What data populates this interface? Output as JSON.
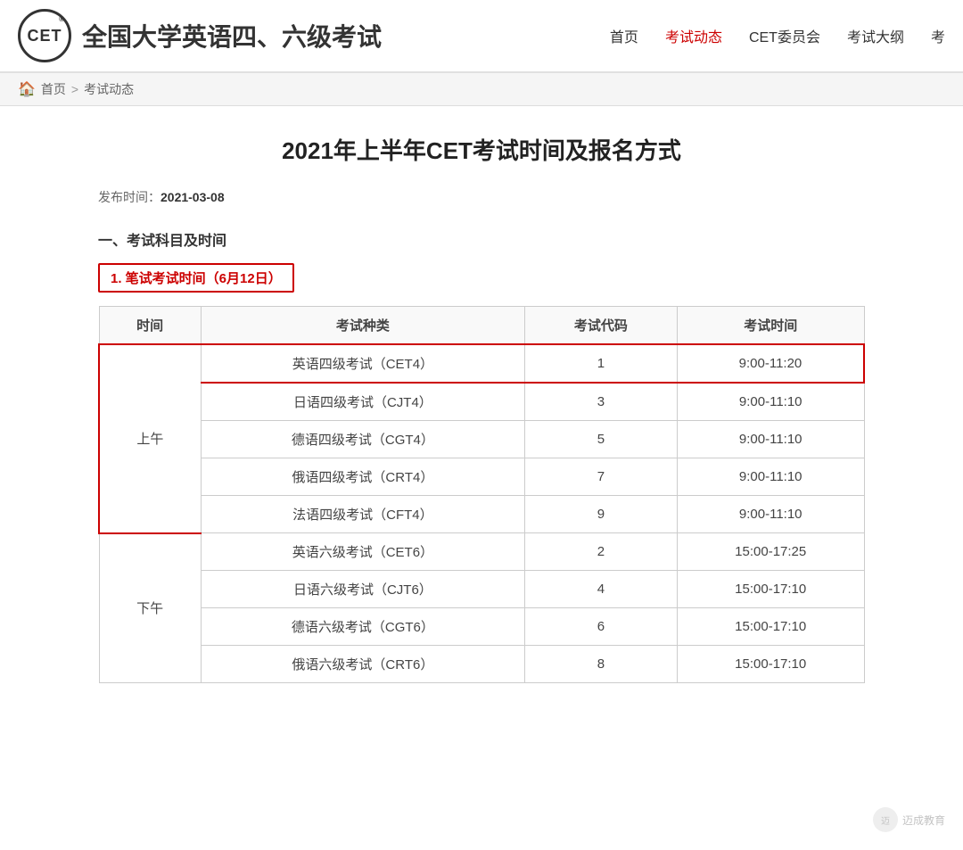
{
  "header": {
    "logo_text": "CET",
    "logo_trademark": "®",
    "site_title": "全国大学英语四、六级考试",
    "nav": [
      {
        "label": "首页",
        "active": false
      },
      {
        "label": "考试动态",
        "active": true
      },
      {
        "label": "CET委员会",
        "active": false
      },
      {
        "label": "考试大纲",
        "active": false
      },
      {
        "label": "考",
        "active": false
      }
    ]
  },
  "breadcrumb": {
    "home_label": "首页",
    "separator": ">",
    "current": "考试动态"
  },
  "article": {
    "title": "2021年上半年CET考试时间及报名方式",
    "publish_label": "发布时间：",
    "publish_date": "2021-03-08",
    "section1_title": "一、考试科目及时间",
    "subsection1_title": "1. 笔试考试时间（6月12日）",
    "table": {
      "headers": [
        "时间",
        "考试种类",
        "考试代码",
        "考试时间"
      ],
      "rows": [
        {
          "period": "上午",
          "period_rowspan": 5,
          "items": [
            {
              "name": "英语四级考试（CET4）",
              "code": "1",
              "time": "9:00-11:20",
              "highlight": true
            },
            {
              "name": "日语四级考试（CJT4）",
              "code": "3",
              "time": "9:00-11:10",
              "highlight": false
            },
            {
              "name": "德语四级考试（CGT4）",
              "code": "5",
              "time": "9:00-11:10",
              "highlight": false
            },
            {
              "name": "俄语四级考试（CRT4）",
              "code": "7",
              "time": "9:00-11:10",
              "highlight": false
            },
            {
              "name": "法语四级考试（CFT4）",
              "code": "9",
              "time": "9:00-11:10",
              "highlight": false
            }
          ]
        },
        {
          "period": "下午",
          "period_rowspan": 4,
          "items": [
            {
              "name": "英语六级考试（CET6）",
              "code": "2",
              "time": "15:00-17:25",
              "highlight": false
            },
            {
              "name": "日语六级考试（CJT6）",
              "code": "4",
              "time": "15:00-17:10",
              "highlight": false
            },
            {
              "name": "德语六级考试（CGT6）",
              "code": "6",
              "time": "15:00-17:10",
              "highlight": false
            },
            {
              "name": "俄语六级考试（CRT6）",
              "code": "8",
              "time": "15:00-17:10",
              "highlight": false
            }
          ]
        }
      ]
    }
  },
  "watermark": {
    "icon_text": "迈",
    "label": "迈成教育"
  }
}
